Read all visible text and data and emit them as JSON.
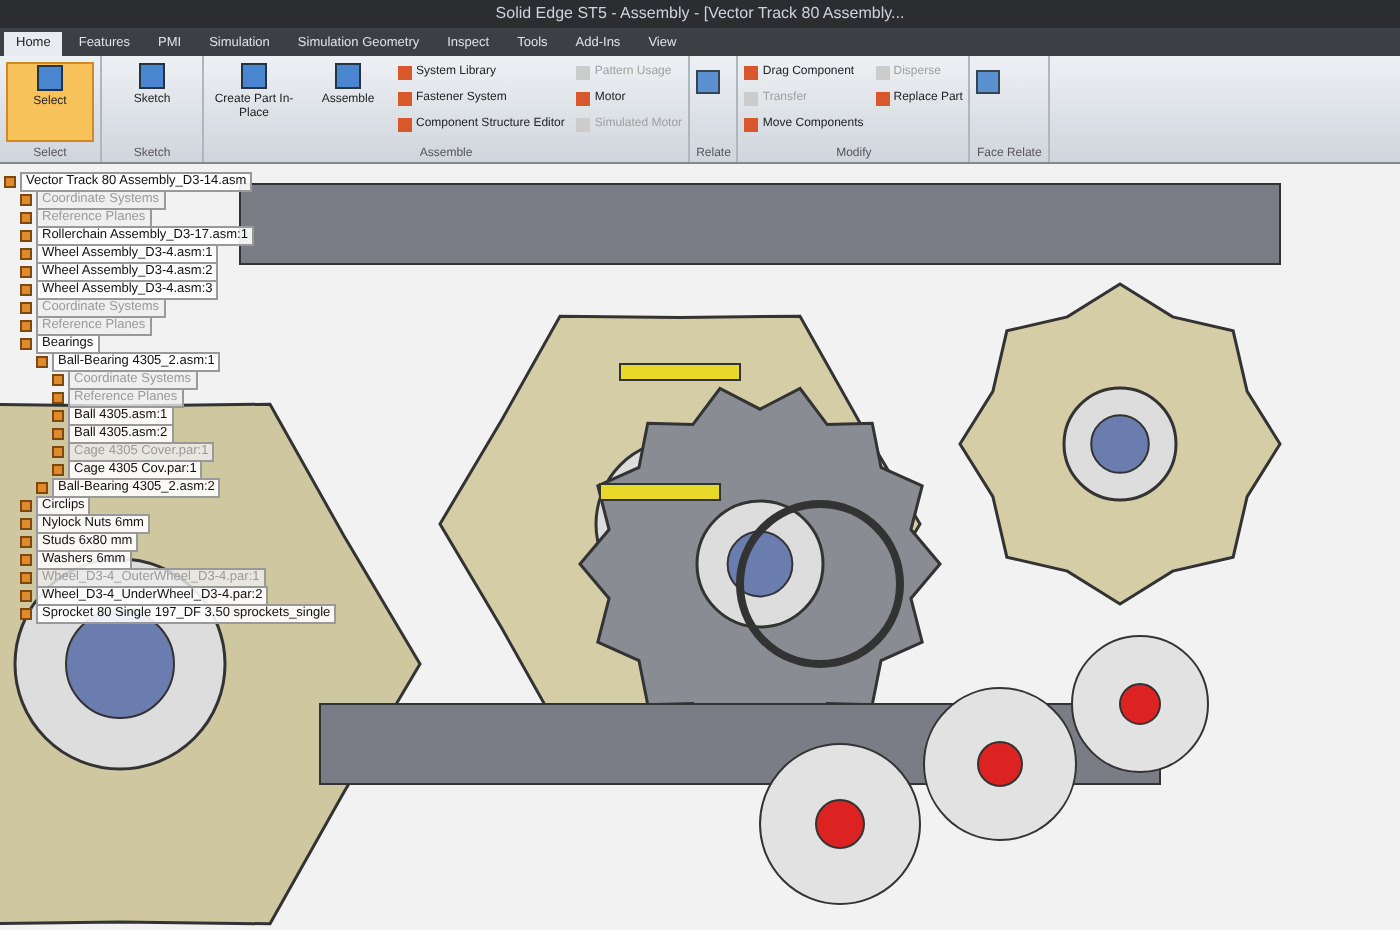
{
  "window": {
    "title": "Solid Edge ST5 - Assembly - [Vector Track 80 Assembly..."
  },
  "tabs": [
    {
      "label": "Home",
      "selected": true
    },
    {
      "label": "Features",
      "selected": false
    },
    {
      "label": "PMI",
      "selected": false
    },
    {
      "label": "Simulation",
      "selected": false
    },
    {
      "label": "Simulation Geometry",
      "selected": false
    },
    {
      "label": "Inspect",
      "selected": false
    },
    {
      "label": "Tools",
      "selected": false
    },
    {
      "label": "Add-Ins",
      "selected": false
    },
    {
      "label": "View",
      "selected": false
    }
  ],
  "ribbon_groups": [
    {
      "label": "Select",
      "commands": [
        {
          "label": "Select",
          "kind": "large",
          "disabled": false
        }
      ]
    },
    {
      "label": "Sketch",
      "commands": [
        {
          "label": "Sketch",
          "kind": "large",
          "disabled": false
        }
      ]
    },
    {
      "label": "Assemble",
      "commands": [
        {
          "label": "Create Part In-Place",
          "kind": "large",
          "disabled": false
        },
        {
          "label": "Assemble",
          "kind": "large",
          "disabled": false
        },
        {
          "label": "System Library",
          "kind": "small",
          "disabled": false
        },
        {
          "label": "Fastener System",
          "kind": "small",
          "disabled": false
        },
        {
          "label": "Component Structure Editor",
          "kind": "small",
          "disabled": false
        },
        {
          "label": "Pattern Usage",
          "kind": "small",
          "disabled": true
        },
        {
          "label": "Motor",
          "kind": "small",
          "disabled": false
        },
        {
          "label": "Simulated Motor",
          "kind": "small",
          "disabled": true
        }
      ]
    },
    {
      "label": "Relate"
    },
    {
      "label": "Modify",
      "commands": [
        {
          "label": "Drag Component",
          "kind": "small",
          "disabled": false
        },
        {
          "label": "Transfer",
          "kind": "small",
          "disabled": true
        },
        {
          "label": "Move Components",
          "kind": "small",
          "disabled": false
        },
        {
          "label": "Disperse",
          "kind": "small",
          "disabled": true
        },
        {
          "label": "Replace Part",
          "kind": "small",
          "disabled": false
        }
      ]
    },
    {
      "label": "Face Relate"
    }
  ],
  "tree": [
    {
      "label": "Vector Track 80 Assembly_D3-14.asm",
      "disabled": false,
      "children": [
        {
          "label": "Coordinate Systems",
          "disabled": true
        },
        {
          "label": "Reference Planes",
          "disabled": true
        },
        {
          "label": "Rollerchain Assembly_D3-17.asm:1",
          "disabled": false
        },
        {
          "label": "Wheel Assembly_D3-4.asm:1",
          "disabled": false
        },
        {
          "label": "Wheel Assembly_D3-4.asm:2",
          "disabled": false
        },
        {
          "label": "Wheel Assembly_D3-4.asm:3",
          "disabled": false
        },
        {
          "label": "Coordinate Systems",
          "disabled": true
        },
        {
          "label": "Reference Planes",
          "disabled": true
        },
        {
          "label": "Bearings",
          "disabled": false,
          "children": [
            {
              "label": "Ball-Bearing 4305_2.asm:1",
              "disabled": false,
              "children": [
                {
                  "label": "Coordinate Systems",
                  "disabled": true
                },
                {
                  "label": "Reference Planes",
                  "disabled": true
                },
                {
                  "label": "Ball 4305.asm:1",
                  "disabled": false
                },
                {
                  "label": "Ball 4305.asm:2",
                  "disabled": false
                },
                {
                  "label": "Cage 4305 Cover.par:1",
                  "disabled": true
                },
                {
                  "label": "Cage 4305 Cov.par:1",
                  "disabled": false
                }
              ]
            },
            {
              "label": "Ball-Bearing 4305_2.asm:2",
              "disabled": false
            }
          ]
        },
        {
          "label": "Circlips",
          "disabled": false
        },
        {
          "label": "Nylock Nuts 6mm",
          "disabled": false
        },
        {
          "label": "Studs 6x80 mm",
          "disabled": false
        },
        {
          "label": "Washers 6mm",
          "disabled": false
        },
        {
          "label": "Wheel_D3-4_OuterWheel_D3-4.par:1",
          "disabled": true
        },
        {
          "label": "Wheel_D3-4_UnderWheel_D3-4.par:2",
          "disabled": false
        },
        {
          "label": "Sprocket 80 Single 197_DF 3.50 sprockets_single",
          "disabled": false
        }
      ]
    }
  ]
}
